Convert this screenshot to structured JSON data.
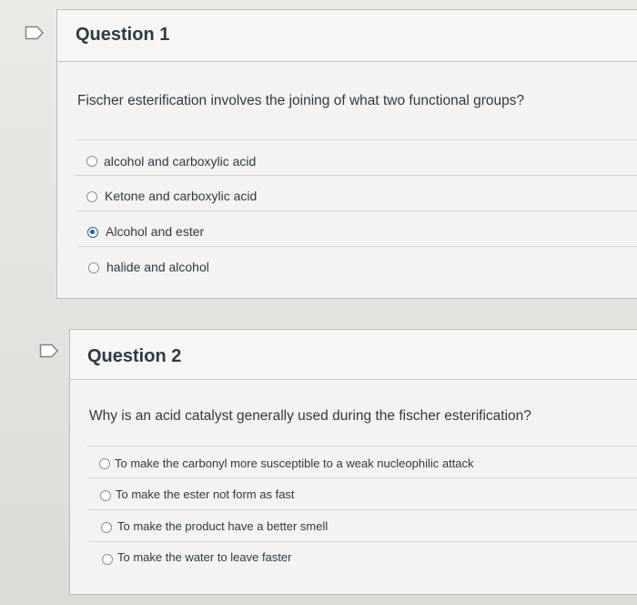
{
  "questions": [
    {
      "title": "Question 1",
      "prompt": "Fischer esterification involves the joining of what two functional groups?",
      "answers": [
        {
          "label": "alcohol and carboxylic acid",
          "selected": false
        },
        {
          "label": "Ketone and carboxylic acid",
          "selected": false
        },
        {
          "label": "Alcohol and ester",
          "selected": true
        },
        {
          "label": "halide and alcohol",
          "selected": false
        }
      ]
    },
    {
      "title": "Question 2",
      "prompt": "Why is an acid catalyst generally used during the fischer esterification?",
      "answers": [
        {
          "label": "To make the carbonyl more susceptible to a weak nucleophilic attack",
          "selected": false
        },
        {
          "label": "To make the ester not form as fast",
          "selected": false
        },
        {
          "label": "To make the product have a better smell",
          "selected": false
        },
        {
          "label": "To make the water to leave faster",
          "selected": false
        }
      ]
    }
  ],
  "icons": {
    "bookmark": "bookmark-flag-icon"
  },
  "colors": {
    "selected_radio": "#1f5fa8",
    "text": "#2d3b45"
  }
}
